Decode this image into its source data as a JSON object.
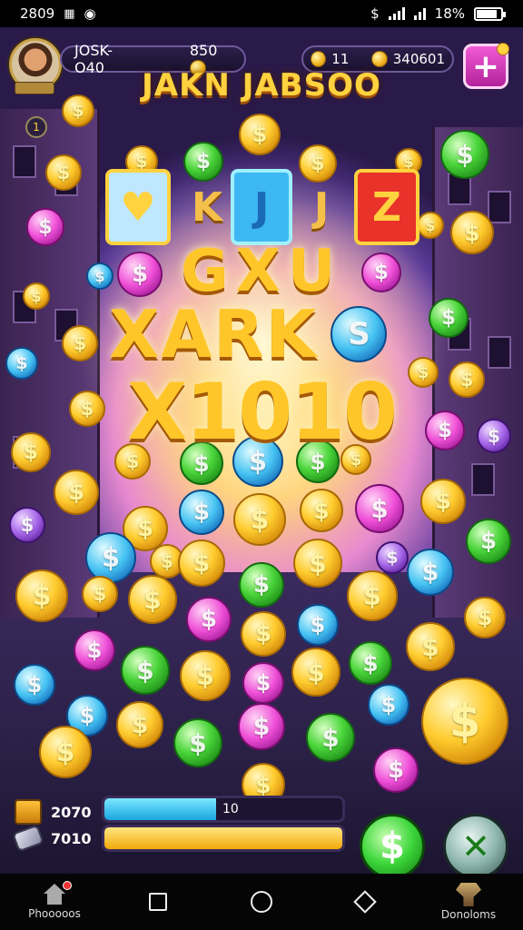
{
  "status_bar": {
    "time": "2809",
    "battery": "18%"
  },
  "hud": {
    "player_name": "JOSK-O40",
    "player_coins": "850",
    "currency_count": "11",
    "gold_total": "340601",
    "add_label": "+"
  },
  "title": "JAKN JABSOO",
  "level": "1",
  "tiles": [
    {
      "label": "♥",
      "color": "#bfe8ff"
    },
    {
      "label": "K",
      "color": "#f4c04a"
    },
    {
      "label": "J",
      "color": "#3db8f2"
    },
    {
      "label": "J",
      "color": "#f4c04a"
    },
    {
      "label": "Z",
      "color": "#e8322a"
    }
  ],
  "line2": "GXU",
  "line3": "XARK",
  "line3_extra": "S",
  "line4": "X1010",
  "bottom": {
    "resource1": "2070",
    "resource2": "7010",
    "bar1_label": "10",
    "bar1_fill": 0.47,
    "bar2_fill": 1.0,
    "spin_symbol": "$",
    "tool_symbol": "✕"
  },
  "nav": {
    "home_label": "Phooooos",
    "profile_label": "Donoloms"
  },
  "colors": {
    "gold": "#ffcc2e",
    "green": "#4ad53a",
    "pink": "#ef4fd7",
    "blue": "#46c3f3",
    "purple": "#a464e8"
  }
}
